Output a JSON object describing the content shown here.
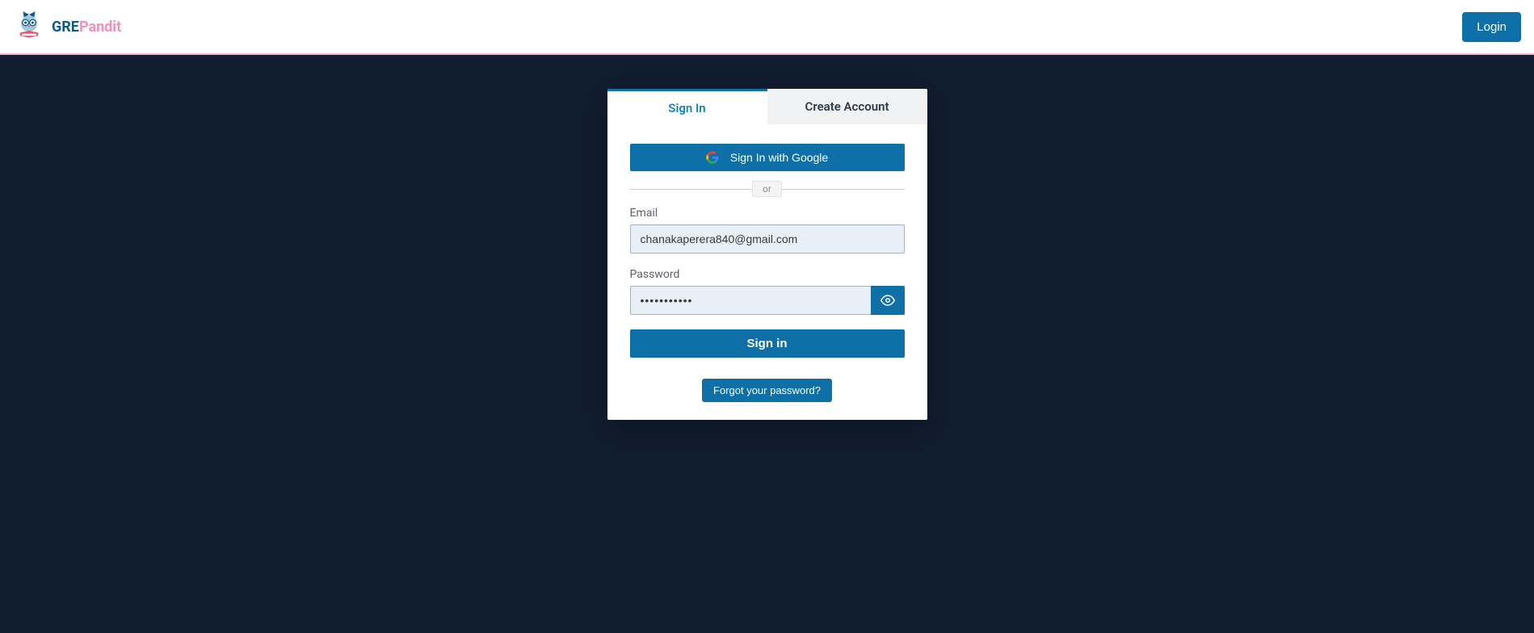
{
  "header": {
    "brand_gre": "GRE",
    "brand_pandit": "Pandit",
    "login_label": "Login"
  },
  "card": {
    "tabs": {
      "signin": "Sign In",
      "create": "Create Account"
    },
    "google_label": "Sign In with Google",
    "divider_text": "or",
    "email_label": "Email",
    "email_value": "chanakaperera840@gmail.com",
    "password_label": "Password",
    "password_value": "•••••••••••",
    "signin_button": "Sign in",
    "forgot_label": "Forgot your password?"
  }
}
